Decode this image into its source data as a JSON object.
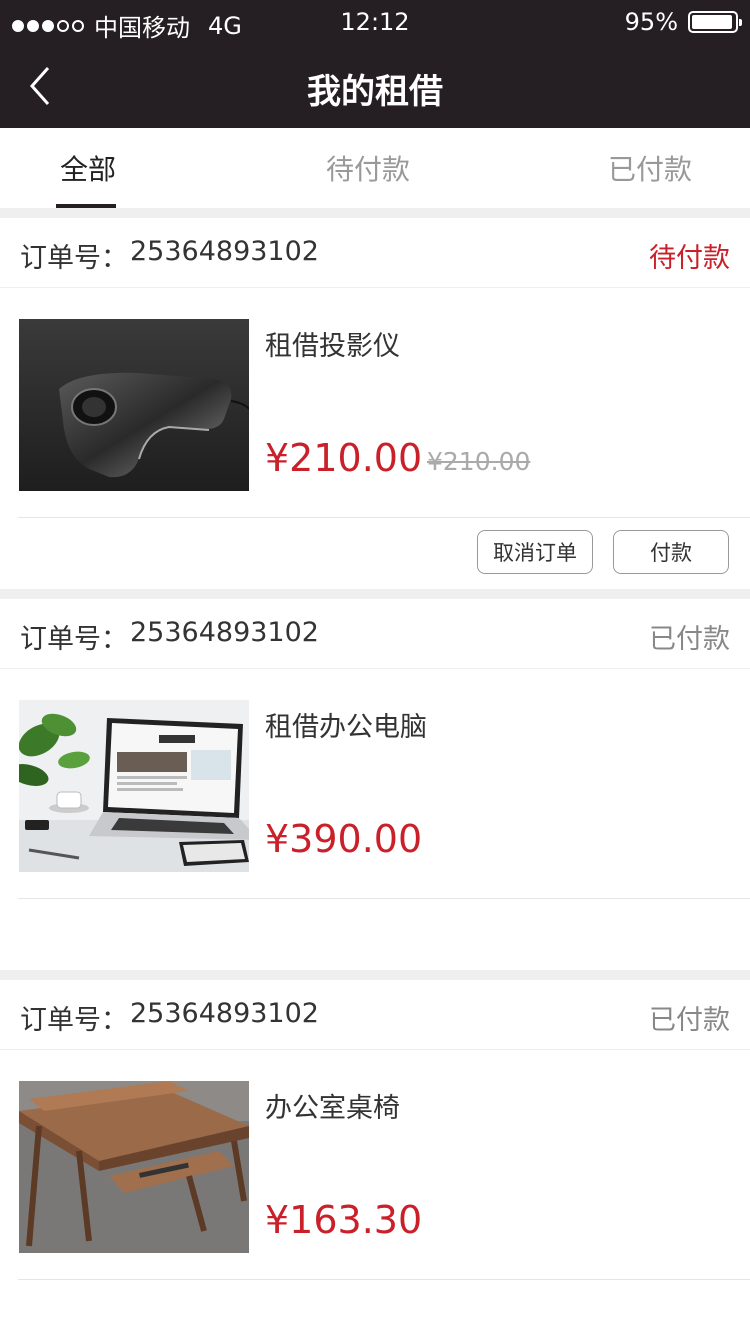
{
  "status_bar": {
    "carrier": "中国移动",
    "network": "4G",
    "time": "12:12",
    "battery_percent_label": "95%",
    "battery_level": 0.95
  },
  "nav": {
    "title": "我的租借",
    "back_icon": "chevron-left-icon"
  },
  "tabs": [
    {
      "label": "全部",
      "active": true
    },
    {
      "label": "待付款",
      "active": false
    },
    {
      "label": "已付款",
      "active": false
    }
  ],
  "orders": [
    {
      "order_label": "订单号：",
      "order_no": "25364893102",
      "status": "待付款",
      "product_name": "租借投影仪",
      "price": "¥210.00",
      "old_price": "¥210.00",
      "image": "projector",
      "actions": [
        "取消订单",
        "付款"
      ]
    },
    {
      "order_label": "订单号：",
      "order_no": "25364893102",
      "status": "已付款",
      "product_name": "租借办公电脑",
      "price": "¥390.00",
      "image": "laptop"
    },
    {
      "order_label": "订单号：",
      "order_no": "25364893102",
      "status": "已付款",
      "product_name": "办公室桌椅",
      "price": "¥163.30",
      "image": "desk"
    }
  ],
  "colors": {
    "nav_bg": "#251e22",
    "accent_red": "#c9202a",
    "muted": "#999999"
  }
}
